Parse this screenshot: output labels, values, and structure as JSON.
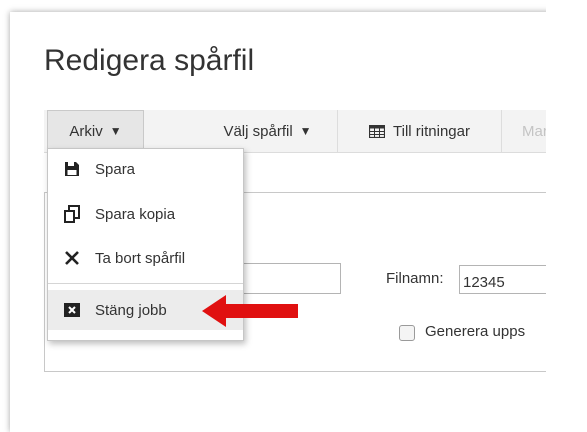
{
  "page": {
    "title": "Redigera spårfil"
  },
  "toolbar": {
    "arkiv_label": "Arkiv",
    "valj_label": "Välj spårfil",
    "till_label": "Till ritningar",
    "markera_label": "Markera",
    "caret": "▼"
  },
  "menu": {
    "items": [
      {
        "label": "Spara",
        "icon": "save-icon"
      },
      {
        "label": "Spara kopia",
        "icon": "copy-icon"
      },
      {
        "label": "Ta bort spårfil",
        "icon": "close-icon"
      },
      {
        "label": "Stäng jobb",
        "icon": "close-box-icon"
      }
    ]
  },
  "form": {
    "filnamn_label": "Filnamn:",
    "filnamn_value": "12345",
    "generera_label": "Generera upps"
  },
  "colors": {
    "arrow": "#e01010",
    "toolbar_bg": "#f3f3f3",
    "highlight": "#ececec"
  }
}
